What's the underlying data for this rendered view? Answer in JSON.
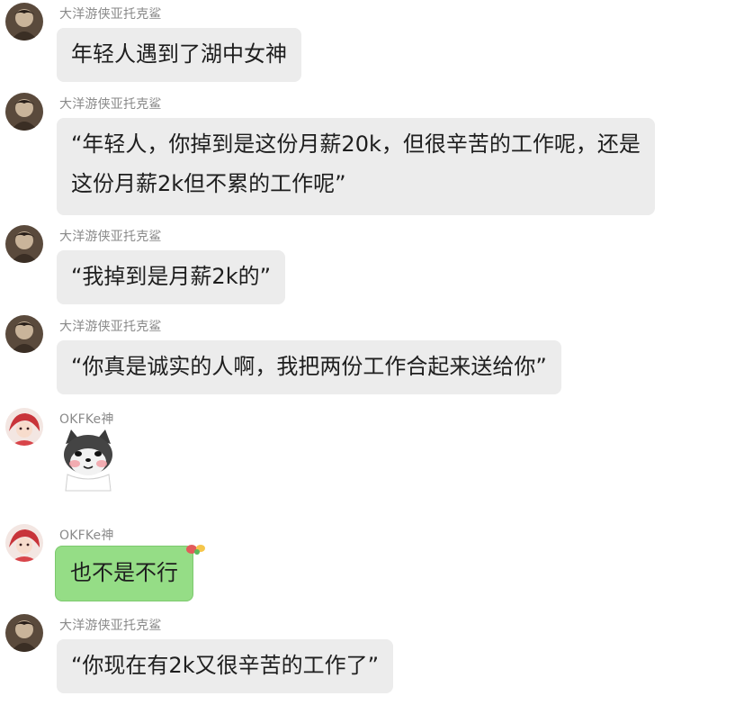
{
  "chat": {
    "users": {
      "user_a": "大洋游侠亚托克鲨",
      "user_b": "OKFKe神"
    },
    "messages": [
      {
        "sender": "大洋游侠亚托克鲨",
        "text": "年轻人遇到了湖中女神"
      },
      {
        "sender": "大洋游侠亚托克鲨",
        "text": "“年轻人，你掉到是这份月薪20k，但很辛苦的工作呢，还是\n这份月薪2k但不累的工作呢”"
      },
      {
        "sender": "大洋游侠亚托克鲨",
        "text": "“我掉到是月薪2k的”"
      },
      {
        "sender": "大洋游侠亚托克鲨",
        "text": "“你真是诚实的人啊，我把两份工作合起来送给你”"
      },
      {
        "sender": "OKFKe神",
        "sticker": "shiba-dog-sticker"
      },
      {
        "sender": "OKFKe神",
        "text": "也不是不行",
        "bubble_color": "#95dd86"
      },
      {
        "sender": "大洋游侠亚托克鲨",
        "text": "“你现在有2k又很辛苦的工作了”"
      }
    ]
  },
  "colors": {
    "bubble_gray": "#ececec",
    "bubble_green": "#95dd86",
    "sender_name": "#8a8a8a",
    "text": "#1e1e1e"
  }
}
